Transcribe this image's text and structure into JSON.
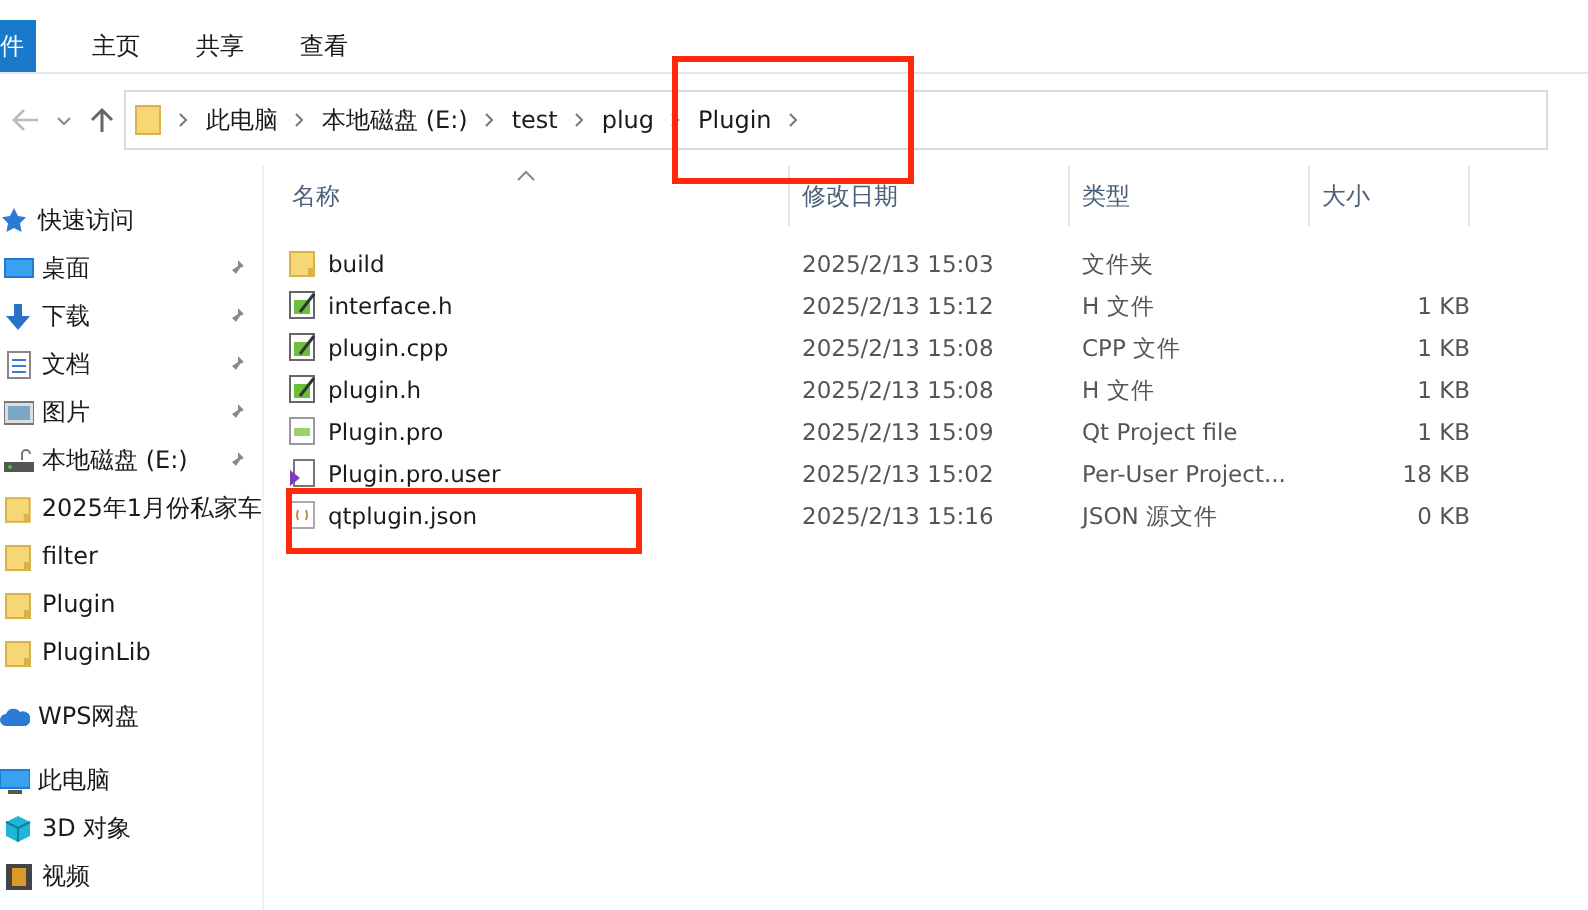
{
  "ribbon": {
    "file_tab": "件",
    "tabs": [
      {
        "label": "主页",
        "selected": false
      },
      {
        "label": "共享",
        "selected": false
      },
      {
        "label": "查看",
        "selected": false
      }
    ]
  },
  "address": {
    "crumbs": [
      "此电脑",
      "本地磁盘 (E:)",
      "test",
      "plug",
      "Plugin"
    ]
  },
  "sidebar": {
    "items": [
      {
        "label": "快速访问",
        "kind": "star",
        "pinned": false,
        "level_in": false
      },
      {
        "label": "桌面",
        "kind": "desktop",
        "pinned": true,
        "level_in": true
      },
      {
        "label": "下载",
        "kind": "download",
        "pinned": true,
        "level_in": true
      },
      {
        "label": "文档",
        "kind": "document",
        "pinned": true,
        "level_in": true
      },
      {
        "label": "图片",
        "kind": "picture",
        "pinned": true,
        "level_in": true
      },
      {
        "label": "本地磁盘 (E:)",
        "kind": "drive",
        "pinned": true,
        "level_in": true
      },
      {
        "label": "2025年1月份私家车",
        "kind": "folder",
        "pinned": false,
        "level_in": true
      },
      {
        "label": "filter",
        "kind": "folder",
        "pinned": false,
        "level_in": true
      },
      {
        "label": "Plugin",
        "kind": "folder",
        "pinned": false,
        "level_in": true
      },
      {
        "label": "PluginLib",
        "kind": "folder",
        "pinned": false,
        "level_in": true
      },
      {
        "label": "WPS网盘",
        "kind": "cloud",
        "pinned": false,
        "level_in": false
      },
      {
        "label": "此电脑",
        "kind": "computer",
        "pinned": false,
        "level_in": false
      },
      {
        "label": "3D 对象",
        "kind": "cube",
        "pinned": false,
        "level_in": true
      },
      {
        "label": "视频",
        "kind": "video",
        "pinned": false,
        "level_in": true
      }
    ]
  },
  "table": {
    "columns": [
      "名称",
      "修改日期",
      "类型",
      "大小"
    ],
    "rows": [
      {
        "kind": "folder",
        "name": "build",
        "date": "2025/2/13 15:03",
        "type": "文件夹",
        "size": ""
      },
      {
        "kind": "source",
        "name": "interface.h",
        "date": "2025/2/13 15:12",
        "type": "H 文件",
        "size": "1 KB"
      },
      {
        "kind": "source",
        "name": "plugin.cpp",
        "date": "2025/2/13 15:08",
        "type": "CPP 文件",
        "size": "1 KB"
      },
      {
        "kind": "source",
        "name": "plugin.h",
        "date": "2025/2/13 15:08",
        "type": "H 文件",
        "size": "1 KB"
      },
      {
        "kind": "pro",
        "name": "Plugin.pro",
        "date": "2025/2/13 15:09",
        "type": "Qt Project file",
        "size": "1 KB"
      },
      {
        "kind": "user",
        "name": "Plugin.pro.user",
        "date": "2025/2/13 15:02",
        "type": "Per-User Project...",
        "size": "18 KB"
      },
      {
        "kind": "json",
        "name": "qtplugin.json",
        "date": "2025/2/13 15:16",
        "type": "JSON 源文件",
        "size": "0 KB"
      }
    ]
  }
}
